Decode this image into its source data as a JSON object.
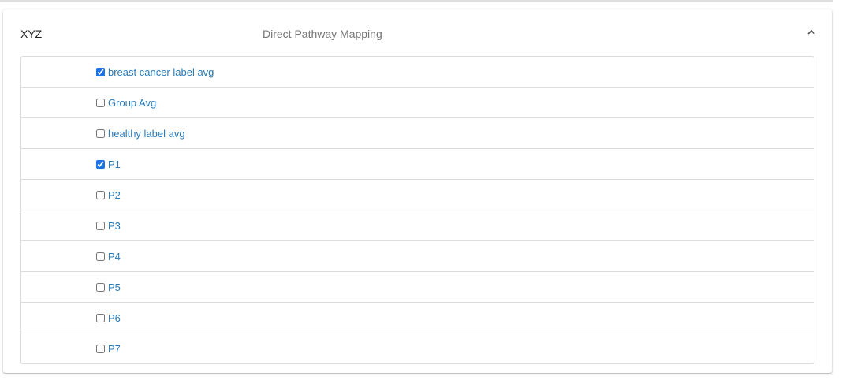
{
  "header": {
    "title": "XYZ",
    "subtitle": "Direct Pathway Mapping",
    "toggle_icon": "chevron-up-icon"
  },
  "items": [
    {
      "label": "breast cancer label avg",
      "checked": true
    },
    {
      "label": "Group Avg",
      "checked": false
    },
    {
      "label": "healthy label avg",
      "checked": false
    },
    {
      "label": "P1",
      "checked": true
    },
    {
      "label": "P2",
      "checked": false
    },
    {
      "label": "P3",
      "checked": false
    },
    {
      "label": "P4",
      "checked": false
    },
    {
      "label": "P5",
      "checked": false
    },
    {
      "label": "P6",
      "checked": false
    },
    {
      "label": "P7",
      "checked": false
    }
  ],
  "colors": {
    "link": "#2a7ab8",
    "checkbox": "#1a73e8"
  }
}
